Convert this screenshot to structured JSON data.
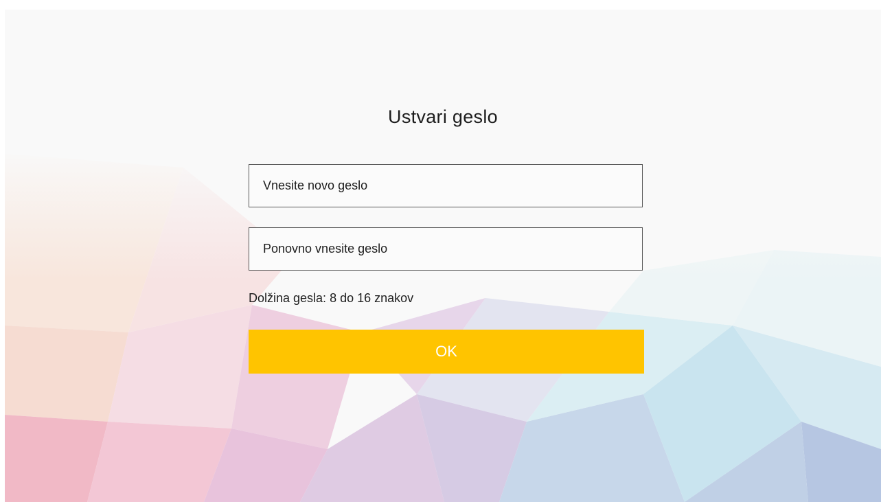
{
  "page": {
    "title": "Ustvari geslo"
  },
  "form": {
    "new_password_placeholder": "Vnesite novo geslo",
    "repeat_password_placeholder": "Ponovno vnesite geslo",
    "hint": "Dolžina gesla: 8 do 16 znakov",
    "ok_label": "OK"
  },
  "colors": {
    "accent": "#ffc400",
    "background": "#f9f9f9",
    "text": "#1d1d1d"
  }
}
